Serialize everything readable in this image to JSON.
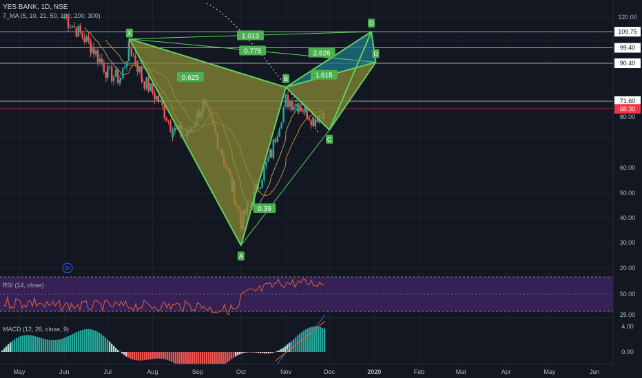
{
  "header": {
    "symbol_line": "YES BANK, 1D, NSE",
    "ma_line": "7_MA (5, 10, 21, 50, 100, 200, 300)"
  },
  "indicators": {
    "rsi_label": "RSI (14, close)",
    "macd_label": "MACD (12, 26, close, 9)",
    "rsi_ticks": [
      "50.00",
      "25.00"
    ],
    "macd_ticks": [
      "4.00",
      "0.00"
    ]
  },
  "price_axis": {
    "ticks": [
      "120.00",
      "80.00",
      "60.00",
      "50.00",
      "40.00",
      "30.00",
      "20.00"
    ],
    "levels": [
      {
        "label": "109.75",
        "value": 109.75,
        "color": "#d1d4dc"
      },
      {
        "label": "99.40",
        "value": 99.4,
        "color": "#d1d4dc"
      },
      {
        "label": "90.40",
        "value": 90.4,
        "color": "#d1d4dc"
      },
      {
        "label": "71.60",
        "value": 71.6,
        "color": "#d1d4dc"
      },
      {
        "label": "68.30",
        "value": 68.3,
        "color": "#f23645"
      }
    ]
  },
  "time_axis": {
    "labels": [
      "May",
      "Jun",
      "Jul",
      "Aug",
      "Sep",
      "Oct",
      "Nov",
      "Dec",
      "2020",
      "Feb",
      "Mar",
      "Apr",
      "May",
      "Jun"
    ]
  },
  "chart_data": {
    "type": "candlestick",
    "symbol": "YES BANK",
    "interval": "1D",
    "exchange": "NSE",
    "scale": "log",
    "harmonic_points": [
      {
        "label": "X",
        "date": "2019-07-16",
        "price": 105
      },
      {
        "label": "A",
        "date": "2019-10-01",
        "price": 29.5
      },
      {
        "label": "B",
        "date": "2019-11-01",
        "price": 78
      },
      {
        "label": "C",
        "date": "2019-12-01",
        "price": 60
      },
      {
        "label": "D",
        "date": "2019-12-30",
        "price": 109.75
      },
      {
        "label": "D",
        "date": "2020-01-02",
        "price": 91
      }
    ],
    "ratios": [
      {
        "label": "1.013",
        "from": "X",
        "to": "D1"
      },
      {
        "label": "0.775",
        "from": "X",
        "to": "D2"
      },
      {
        "label": "0.625",
        "from": "X",
        "to": "B"
      },
      {
        "label": "2.626",
        "from": "B",
        "to": "D1"
      },
      {
        "label": "1.615",
        "from": "B",
        "to": "D2"
      },
      {
        "label": "0.39",
        "from": "A",
        "to": "C"
      }
    ],
    "horizontal_levels": [
      109.75,
      99.4,
      90.4,
      71.6,
      68.3
    ],
    "price_path": [
      {
        "date": "2019-06-01",
        "price": 120
      },
      {
        "date": "2019-06-20",
        "price": 100
      },
      {
        "date": "2019-07-01",
        "price": 85
      },
      {
        "date": "2019-07-10",
        "price": 82
      },
      {
        "date": "2019-07-16",
        "price": 100
      },
      {
        "date": "2019-07-25",
        "price": 82
      },
      {
        "date": "2019-08-05",
        "price": 72
      },
      {
        "date": "2019-08-15",
        "price": 60
      },
      {
        "date": "2019-08-25",
        "price": 58
      },
      {
        "date": "2019-09-05",
        "price": 70
      },
      {
        "date": "2019-09-15",
        "price": 56
      },
      {
        "date": "2019-09-25",
        "price": 42
      },
      {
        "date": "2019-10-01",
        "price": 34
      },
      {
        "date": "2019-10-10",
        "price": 40
      },
      {
        "date": "2019-10-22",
        "price": 52
      },
      {
        "date": "2019-11-01",
        "price": 72
      },
      {
        "date": "2019-11-10",
        "price": 70
      },
      {
        "date": "2019-11-20",
        "price": 64
      },
      {
        "date": "2019-11-28",
        "price": 68
      }
    ],
    "xlim": [
      "2019-05-01",
      "2020-06-10"
    ],
    "ylim": [
      17,
      128
    ],
    "colors": {
      "up": "#26a69a",
      "down": "#ef5350",
      "pattern_line": "#5fd35f",
      "fill_olive": "#8a8a35",
      "fill_teal": "#1e7a8a"
    }
  },
  "annotations": {
    "event_badge": "D"
  }
}
